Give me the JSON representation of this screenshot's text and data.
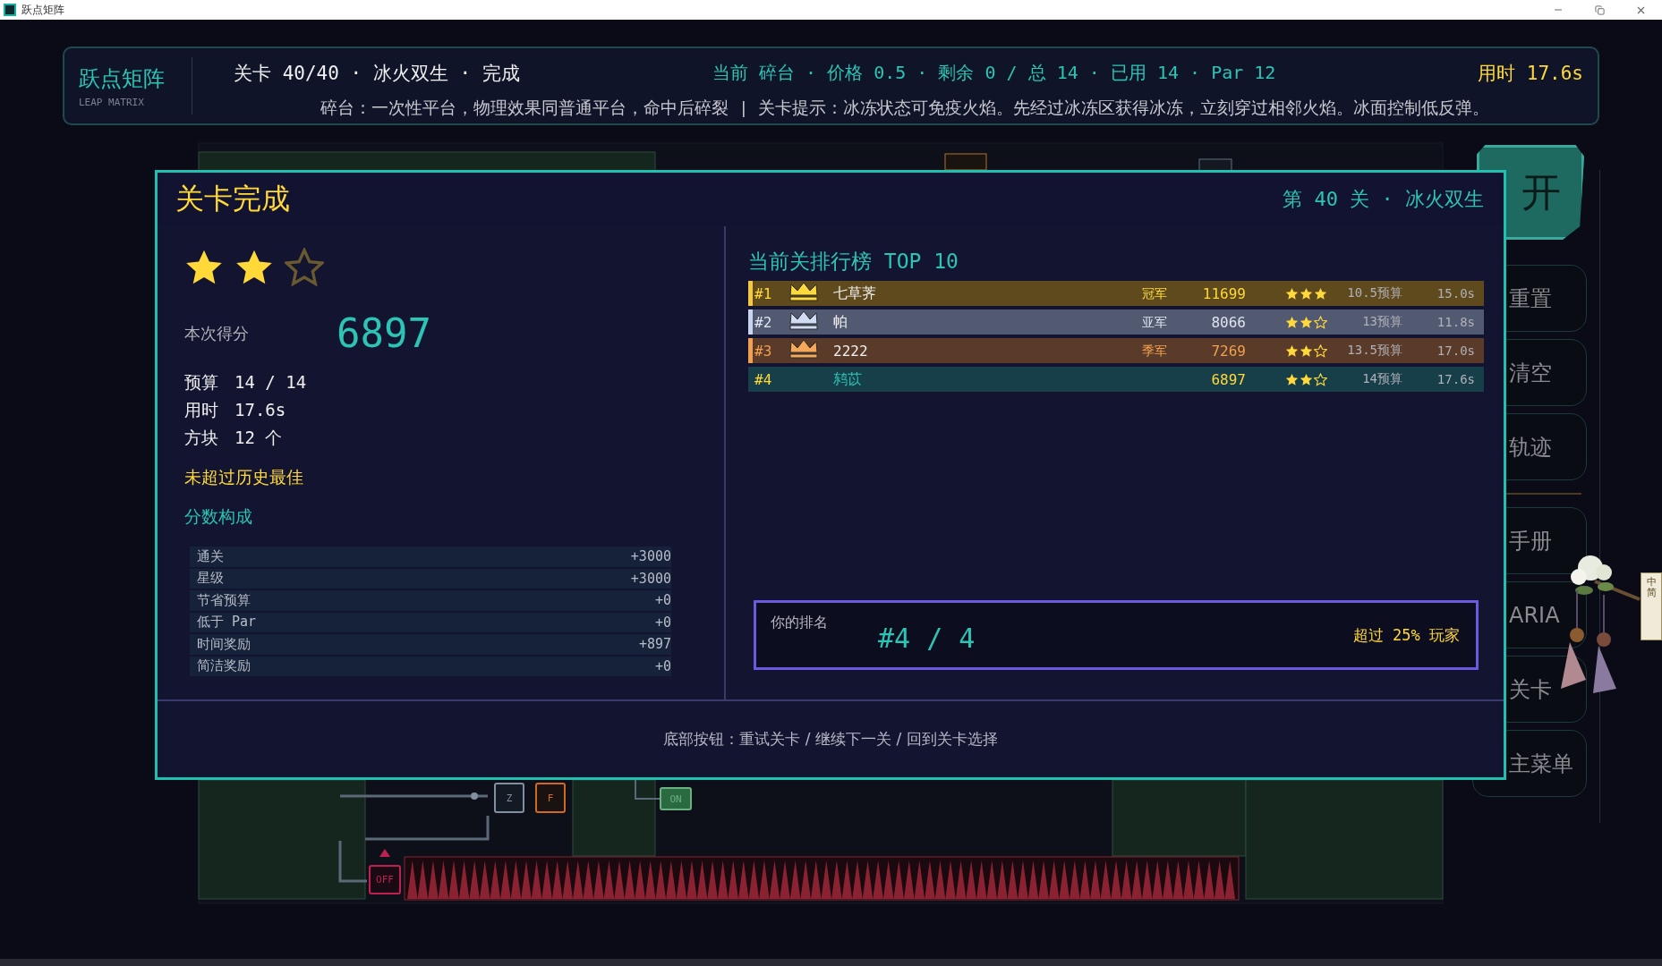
{
  "title_bar": {
    "title": "跃点矩阵"
  },
  "hud": {
    "brand": "跃点矩阵",
    "brand_sub": "LEAP MATRIX",
    "level": "关卡 40/40 · 冰火双生 · 完成",
    "current": "当前 碎台 · 价格 0.5 · 剩余 0 / 总 14 · 已用 14 · Par 12",
    "timer": "用时 17.6s",
    "hint": "碎台：一次性平台，物理效果同普通平台，命中后碎裂 | 关卡提示：冰冻状态可免疫火焰。先经过冰冻区获得冰冻，立刻穿过相邻火焰。冰面控制低反弹。"
  },
  "level": {
    "switches": [
      {
        "kind": "gate",
        "text": "Z"
      },
      {
        "kind": "fire",
        "text": "F"
      },
      {
        "kind": "on",
        "text": "ON"
      },
      {
        "kind": "off",
        "text": "OFF"
      }
    ]
  },
  "sidebar": {
    "items": [
      {
        "kind": "primary",
        "label": "开"
      },
      {
        "kind": "normal",
        "label": "重置"
      },
      {
        "kind": "normal",
        "label": "清空"
      },
      {
        "kind": "normal",
        "label": "轨迹"
      },
      {
        "kind": "normal",
        "label": "手册"
      },
      {
        "kind": "normal",
        "label": "ARIA"
      },
      {
        "kind": "normal",
        "label": "关卡"
      },
      {
        "kind": "normal",
        "label": "主菜单"
      }
    ]
  },
  "language_tag": "中简",
  "modal": {
    "title": "关卡完成",
    "subtitle": "第 40 关 · 冰火双生",
    "stars": 2,
    "score_label": "本次得分",
    "score": "6897",
    "stats": [
      {
        "label": "预算",
        "value": "14 / 14"
      },
      {
        "label": "用时",
        "value": "17.6s"
      },
      {
        "label": "方块",
        "value": "12 个"
      }
    ],
    "best_note": "未超过历史最佳",
    "breakdown_title": "分数构成",
    "breakdown": [
      {
        "label": "通关",
        "value": "+3000"
      },
      {
        "label": "星级",
        "value": "+3000"
      },
      {
        "label": "节省预算",
        "value": "+0"
      },
      {
        "label": "低于 Par",
        "value": "+0"
      },
      {
        "label": "时间奖励",
        "value": "+897"
      },
      {
        "label": "简洁奖励",
        "value": "+0"
      }
    ],
    "leaderboard": {
      "title": "当前关排行榜 TOP 10",
      "rows": [
        {
          "kind": "gold",
          "rank": "#1",
          "name": "七草荠",
          "badge": "冠军",
          "score": "11699",
          "stars": 3,
          "budget": "10.5预算",
          "time": "15.0s"
        },
        {
          "kind": "silver",
          "rank": "#2",
          "name": "帕",
          "badge": "亚军",
          "score": "8066",
          "stars": 2,
          "budget": "13预算",
          "time": "11.8s"
        },
        {
          "kind": "bronze",
          "rank": "#3",
          "name": "2222",
          "badge": "季军",
          "score": "7269",
          "stars": 2,
          "budget": "13.5预算",
          "time": "17.0s"
        },
        {
          "kind": "player",
          "rank": "#4",
          "name": "鸫苡",
          "score": "6897",
          "stars": 2,
          "budget": "14预算",
          "time": "17.6s"
        }
      ]
    },
    "my_rank": {
      "label": "你的排名",
      "rank": "#4 / 4",
      "note": "超过 25% 玩家"
    },
    "footer": "底部按钮：重试关卡 / 继续下一关 / 回到关卡选择"
  }
}
